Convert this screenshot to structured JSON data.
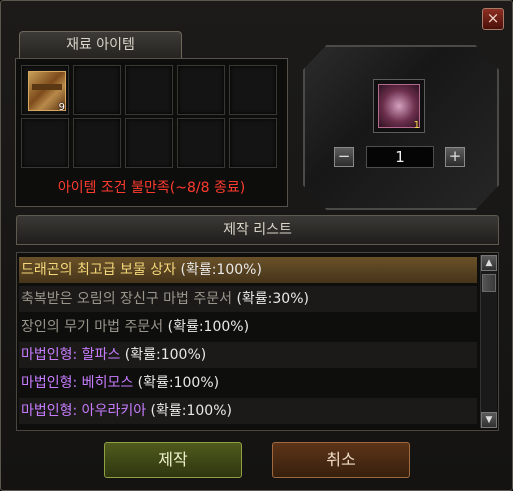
{
  "window": {
    "close_label": "×"
  },
  "materials": {
    "tab_label": "재료 아이템",
    "slots": [
      {
        "icon": "treasure-chest-icon",
        "count": "9"
      },
      {},
      {},
      {},
      {},
      {},
      {},
      {},
      {},
      {}
    ],
    "condition_text": "아이템 조건 불만족(~8/8 종료)"
  },
  "result": {
    "icon": "enchant-scroll-icon",
    "count": "1",
    "quantity": "1",
    "minus_label": "−",
    "plus_label": "+"
  },
  "craft_list": {
    "header": "제작 리스트",
    "items": [
      {
        "name": "드래곤의 최고급 보물 상자",
        "prob": "(확률:100%)",
        "name_color": "#f4d87a",
        "selected": true
      },
      {
        "name": "축복받은 오림의 장신구 마법 주문서",
        "prob": "(확률:30%)",
        "name_color": "#9a968c"
      },
      {
        "name": "장인의 무기 마법 주문서",
        "prob": "(확률:100%)",
        "name_color": "#9a968c"
      },
      {
        "name": "마법인형: 할파스",
        "prob": "(확률:100%)",
        "name_color": "#c77cff"
      },
      {
        "name": "마법인형: 베히모스",
        "prob": "(확률:100%)",
        "name_color": "#c77cff"
      },
      {
        "name": "마법인형: 아우라키아",
        "prob": "(확률:100%)",
        "name_color": "#c77cff"
      }
    ],
    "scroll_up": "▲",
    "scroll_down": "▼"
  },
  "buttons": {
    "make": "제작",
    "cancel": "취소"
  }
}
